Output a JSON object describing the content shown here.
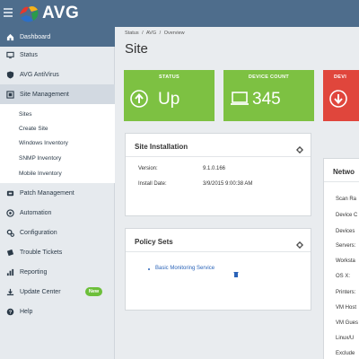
{
  "brand": {
    "name": "AVG"
  },
  "sidebar": {
    "items": [
      {
        "label": "Dashboard",
        "icon": "home-icon"
      },
      {
        "label": "Status",
        "icon": "monitor-icon"
      },
      {
        "label": "AVG AntiVirus",
        "icon": "shield-icon"
      },
      {
        "label": "Site Management",
        "icon": "site-icon"
      },
      {
        "label": "Patch Management",
        "icon": "patch-icon"
      },
      {
        "label": "Automation",
        "icon": "automation-icon"
      },
      {
        "label": "Configuration",
        "icon": "gear-icon"
      },
      {
        "label": "Trouble Tickets",
        "icon": "ticket-icon"
      },
      {
        "label": "Reporting",
        "icon": "chart-icon"
      },
      {
        "label": "Update Center",
        "icon": "download-icon",
        "badge": "New"
      },
      {
        "label": "Help",
        "icon": "help-icon"
      }
    ],
    "sub_items": [
      "Sites",
      "Create Site",
      "Windows Inventory",
      "SNMP Inventory",
      "Mobile Inventory"
    ]
  },
  "breadcrumb": [
    "Status",
    "/",
    "AVG",
    "/",
    "Overview"
  ],
  "page": {
    "title": "Site"
  },
  "tiles": [
    {
      "label": "STATUS",
      "value": "Up",
      "color": "#7dc142",
      "icon": "arrow-up-circle-icon"
    },
    {
      "label": "DEVICE COUNT",
      "value": "345",
      "color": "#7dc142",
      "icon": "laptop-icon"
    },
    {
      "label": "DEVI",
      "value": "",
      "color": "#e0463c",
      "icon": "arrow-down-circle-icon"
    }
  ],
  "site_installation": {
    "title": "Site Installation",
    "rows": [
      {
        "key": "Version:",
        "value": "9.1.0.166"
      },
      {
        "key": "Install Date:",
        "value": "3/9/2015 9:00:38 AM"
      }
    ]
  },
  "policy_sets": {
    "title": "Policy Sets",
    "items": [
      "Basic Monitoring Service"
    ]
  },
  "network": {
    "title": "Netwo",
    "items": [
      "Scan Ra",
      "Device C",
      "Devices",
      "Servers:",
      "Worksta",
      "OS X:",
      "Printers:",
      "VM Host",
      "VM Gues",
      "Linux/U",
      "Exclude"
    ]
  },
  "colors": {
    "topbar": "#4e6d8c",
    "accent": "#4e6d8c",
    "green": "#7dc142",
    "red": "#e0463c"
  }
}
